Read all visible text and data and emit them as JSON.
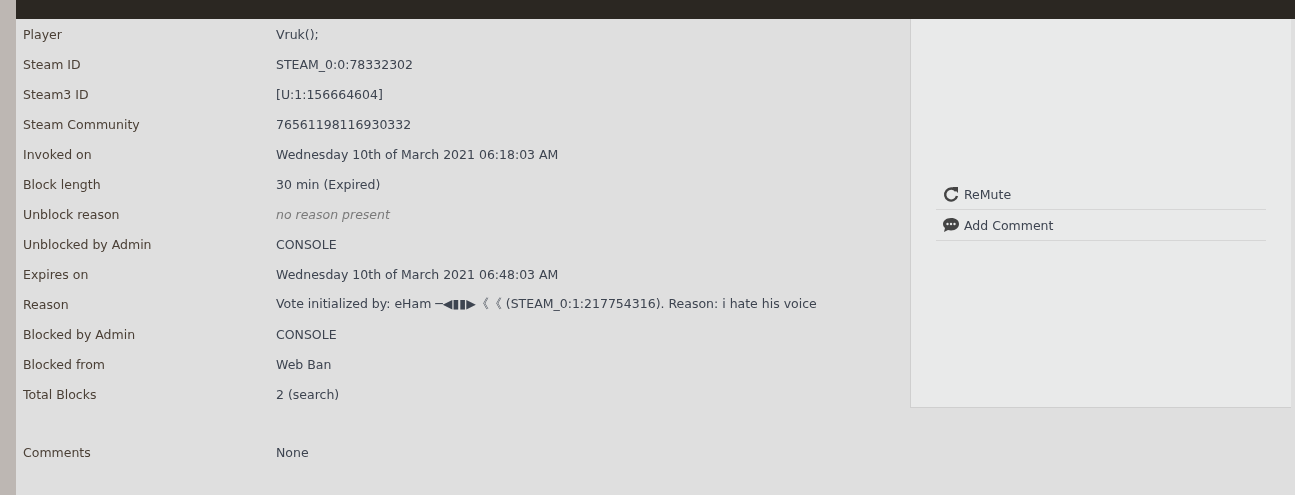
{
  "details": [
    {
      "label": "Player",
      "value": "Vruk();",
      "kind": "text"
    },
    {
      "label": "Steam ID",
      "value": "STEAM_0:0:78332302",
      "kind": "text"
    },
    {
      "label": "Steam3 ID",
      "value": "[U:1:156664604]",
      "kind": "text"
    },
    {
      "label": "Steam Community",
      "value": "76561198116930332",
      "kind": "text"
    },
    {
      "label": "Invoked on",
      "value": "Wednesday 10th of March 2021 06:18:03 AM",
      "kind": "text"
    },
    {
      "label": "Block length",
      "value": "30 min (Expired)",
      "kind": "text"
    },
    {
      "label": "Unblock reason",
      "value": "no reason present",
      "kind": "note"
    },
    {
      "label": "Unblocked by Admin",
      "value": "CONSOLE",
      "kind": "text"
    },
    {
      "label": "Expires on",
      "value": "Wednesday 10th of March 2021 06:48:03 AM",
      "kind": "text"
    },
    {
      "label": "Reason",
      "value": "Vote initialized by: eHam ─◀▮▮▶《《 (STEAM_0:1:217754316). Reason: i hate his voice",
      "kind": "text"
    },
    {
      "label": "Blocked by Admin",
      "value": "CONSOLE",
      "kind": "text"
    },
    {
      "label": "Blocked from",
      "value": "Web Ban",
      "kind": "text"
    },
    {
      "label": "Total Blocks",
      "value": "2 (search)",
      "kind": "text"
    }
  ],
  "actions": [
    {
      "label": "ReMute",
      "kind": "remute"
    },
    {
      "label": "Add Comment",
      "kind": "comment"
    }
  ],
  "comments": {
    "label": "Comments",
    "value": "None"
  }
}
